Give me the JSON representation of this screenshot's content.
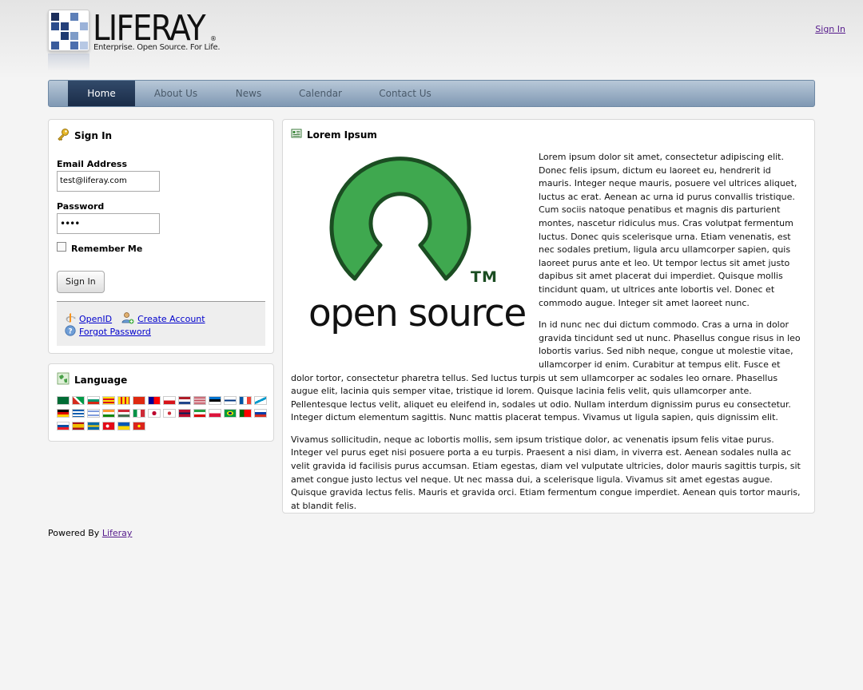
{
  "header": {
    "logo_word": "LIFERAY",
    "logo_reg": "®",
    "logo_tagline": "Enterprise. Open Source. For Life.",
    "sign_in_link": "Sign In"
  },
  "nav": {
    "items": [
      {
        "label": "Home",
        "active": true
      },
      {
        "label": "About Us",
        "active": false
      },
      {
        "label": "News",
        "active": false
      },
      {
        "label": "Calendar",
        "active": false
      },
      {
        "label": "Contact Us",
        "active": false
      }
    ]
  },
  "signin_portlet": {
    "title": "Sign In",
    "email_label": "Email Address",
    "email_value": "test@liferay.com",
    "password_label": "Password",
    "password_value": "••••",
    "remember_label": "Remember Me",
    "submit_label": "Sign In",
    "openid_link": "OpenID",
    "create_account_link": "Create Account",
    "forgot_password_link": "Forgot Password"
  },
  "language_portlet": {
    "title": "Language",
    "flags": [
      "arabic",
      "basque",
      "bulgarian",
      "catalan",
      "catalan-alt",
      "chinese-cn",
      "chinese-tw",
      "czech",
      "dutch",
      "english",
      "estonian",
      "finnish",
      "french",
      "galician",
      "german",
      "greek",
      "hebrew",
      "hindi",
      "hungarian",
      "italian",
      "japanese",
      "korean",
      "norwegian",
      "persian",
      "polish",
      "portuguese-br",
      "portuguese-pt",
      "russian",
      "slovak",
      "spanish",
      "swedish",
      "turkish",
      "ukrainian",
      "vietnamese"
    ]
  },
  "article_portlet": {
    "title": "Lorem Ipsum",
    "image_tm": "TM",
    "image_text": "open source",
    "paragraphs": [
      "Lorem ipsum dolor sit amet, consectetur adipiscing elit. Donec felis ipsum, dictum eu laoreet eu, hendrerit id mauris. Integer neque mauris, posuere vel ultrices aliquet, luctus ac erat. Aenean ac urna id purus convallis tristique. Cum sociis natoque penatibus et magnis dis parturient montes, nascetur ridiculus mus. Cras volutpat fermentum luctus. Donec quis scelerisque urna. Etiam venenatis, est nec sodales pretium, ligula arcu ullamcorper sapien, quis laoreet purus ante et leo. Ut tempor lectus sit amet justo dapibus sit amet placerat dui imperdiet. Quisque mollis tincidunt quam, ut ultrices ante lobortis vel. Donec et commodo augue. Integer sit amet laoreet nunc.",
      "In id nunc nec dui dictum commodo. Cras a urna in dolor gravida tincidunt sed ut nunc. Phasellus congue risus in leo lobortis varius. Sed nibh neque, congue ut molestie vitae, ullamcorper id enim. Curabitur at tempus elit. Fusce et dolor tortor, consectetur pharetra tellus. Sed luctus turpis ut sem ullamcorper ac sodales leo ornare. Phasellus augue elit, lacinia quis semper vitae, tristique id lorem. Quisque lacinia felis velit, quis ullamcorper ante. Pellentesque lectus velit, aliquet eu eleifend in, sodales ut odio. Nullam interdum dignissim purus eu consectetur. Integer dictum elementum sagittis. Nunc mattis placerat tempus. Vivamus ut ligula sapien, quis dignissim elit.",
      "Vivamus sollicitudin, neque ac lobortis mollis, sem ipsum tristique dolor, ac venenatis ipsum felis vitae purus. Integer vel purus eget nisi posuere porta a eu turpis. Praesent a nisi diam, in viverra est. Aenean sodales nulla ac velit gravida id facilisis purus accumsan. Etiam egestas, diam vel vulputate ultricies, dolor mauris sagittis turpis, sit amet congue justo lectus vel neque. Ut nec massa dui, a scelerisque ligula. Vivamus sit amet egestas augue. Quisque gravida lectus felis. Mauris et gravida orci. Etiam fermentum congue imperdiet. Aenean quis tortor mauris, at blandit felis."
    ]
  },
  "footer": {
    "powered_prefix": "Powered By",
    "powered_link": "Liferay"
  },
  "colors": {
    "nav_active": "#1f3352",
    "link": "#0000cc",
    "visited_link": "#551a8b",
    "opensource_green": "#3fa84f",
    "opensource_dark": "#1b4d22"
  }
}
